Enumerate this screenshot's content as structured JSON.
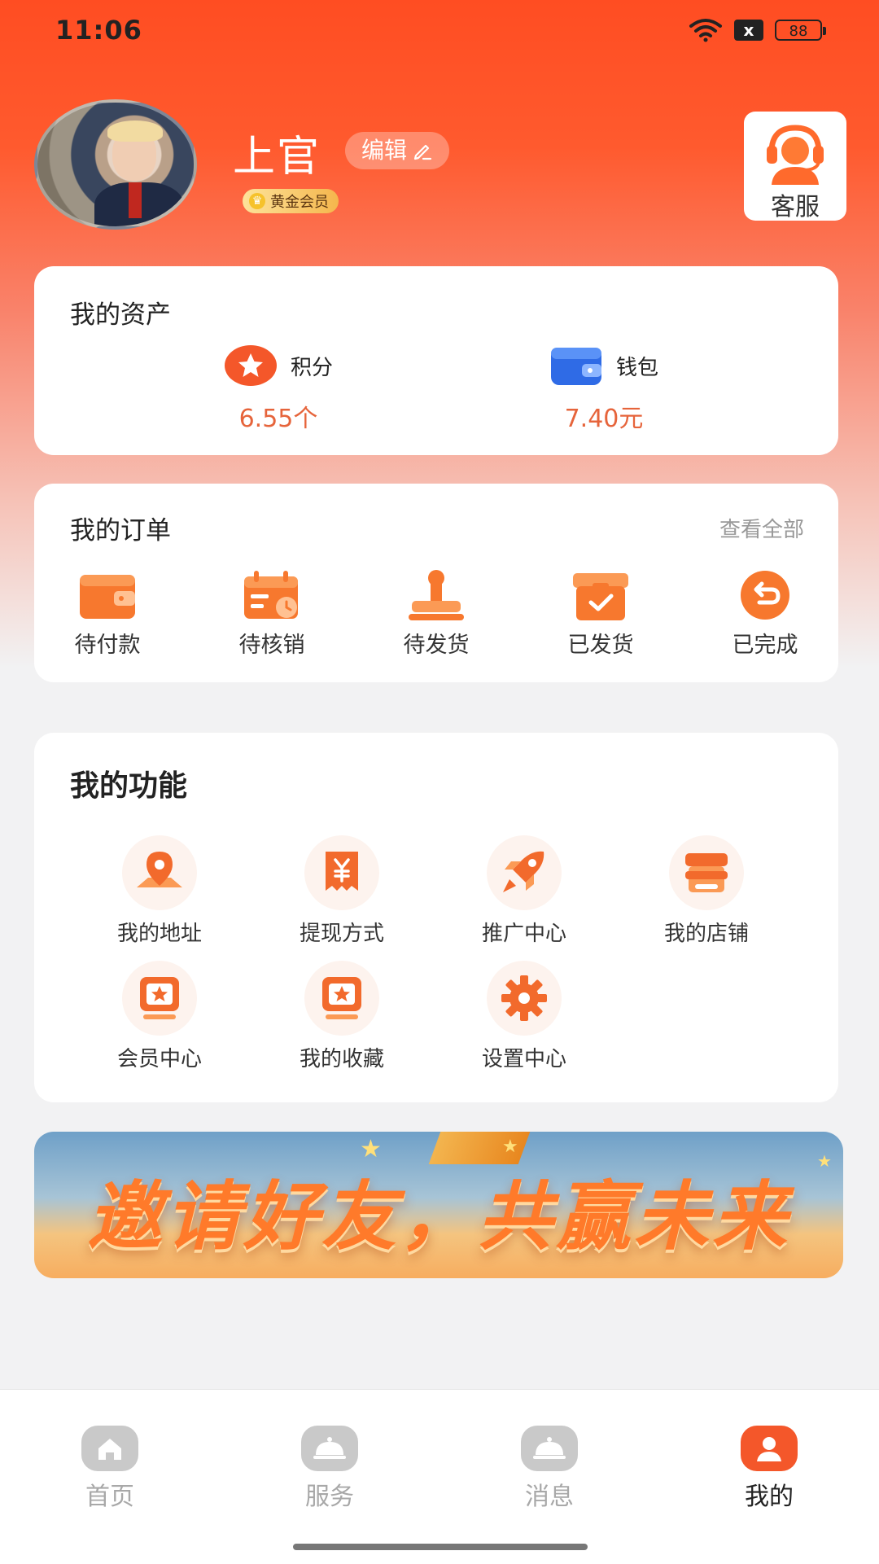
{
  "status_bar": {
    "time": "11:06",
    "battery": "88",
    "notification_badge": "x"
  },
  "profile": {
    "name": "上官",
    "edit_label": "编辑",
    "member_level": "黄金会员",
    "service_label": "客服"
  },
  "assets": {
    "title": "我的资产",
    "items": [
      {
        "label": "积分",
        "value": "6.55个",
        "icon": "star-badge-icon"
      },
      {
        "label": "钱包",
        "value": "7.40元",
        "icon": "wallet-icon"
      }
    ]
  },
  "orders": {
    "title": "我的订单",
    "view_all": "查看全部",
    "items": [
      {
        "label": "待付款",
        "icon": "wallet-card-icon"
      },
      {
        "label": "待核销",
        "icon": "calendar-clock-icon"
      },
      {
        "label": "待发货",
        "icon": "stamp-icon"
      },
      {
        "label": "已发货",
        "icon": "box-check-icon"
      },
      {
        "label": "已完成",
        "icon": "return-circle-icon"
      }
    ]
  },
  "functions": {
    "title": "我的功能",
    "items": [
      {
        "label": "我的地址",
        "icon": "location-pin-icon"
      },
      {
        "label": "提现方式",
        "icon": "yen-voucher-icon"
      },
      {
        "label": "推广中心",
        "icon": "rocket-icon"
      },
      {
        "label": "我的店铺",
        "icon": "store-icon"
      },
      {
        "label": "会员中心",
        "icon": "member-star-icon"
      },
      {
        "label": "我的收藏",
        "icon": "favorite-star-icon"
      },
      {
        "label": "设置中心",
        "icon": "gear-icon"
      }
    ]
  },
  "banner": {
    "text": "邀请好友，共赢未来"
  },
  "tab_bar": {
    "items": [
      {
        "label": "首页",
        "icon": "home-icon",
        "active": false
      },
      {
        "label": "服务",
        "icon": "service-bell-icon",
        "active": false
      },
      {
        "label": "消息",
        "icon": "message-bell-icon",
        "active": false
      },
      {
        "label": "我的",
        "icon": "user-icon",
        "active": true
      }
    ]
  },
  "colors": {
    "accent": "#ff5a2e",
    "value_text": "#e6643b",
    "tab_inactive": "#a8a8a8"
  }
}
